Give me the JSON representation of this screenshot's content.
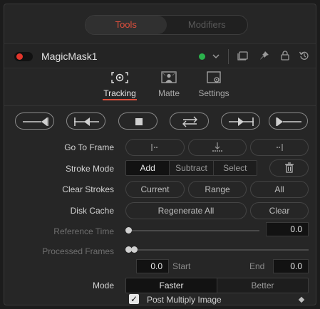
{
  "top_tabs": [
    {
      "label": "Tools",
      "active": true
    },
    {
      "label": "Modifiers",
      "active": false
    }
  ],
  "node": {
    "name": "MagicMask1",
    "enabled_color": "#e2352b",
    "status_color": "#2bb24c",
    "icons": [
      "chevron-down-icon",
      "version-icon",
      "pin-icon",
      "lock-icon",
      "reset-icon"
    ]
  },
  "sub_tabs": [
    {
      "label": "Tracking",
      "icon": "tracking-target-icon",
      "active": true
    },
    {
      "label": "Matte",
      "icon": "matte-icon",
      "active": false
    },
    {
      "label": "Settings",
      "icon": "settings-icon",
      "active": false
    }
  ],
  "transport": [
    "track-to-start",
    "track-backward-one-frame",
    "stop",
    "track-bidirectional",
    "track-forward-one-frame",
    "track-to-end"
  ],
  "go_to_frame": {
    "label": "Go To Frame",
    "icons": [
      "go-to-start-icon",
      "go-to-current-icon",
      "go-to-end-icon"
    ]
  },
  "stroke_mode": {
    "label": "Stroke Mode",
    "options": [
      "Add",
      "Subtract",
      "Select"
    ],
    "selected": "Add",
    "delete_icon": "trash-icon"
  },
  "clear_strokes": {
    "label": "Clear Strokes",
    "buttons": [
      "Current",
      "Range",
      "All"
    ]
  },
  "disk_cache": {
    "label": "Disk Cache",
    "regenerate": "Regenerate All",
    "clear": "Clear"
  },
  "reference_time": {
    "label": "Reference Time",
    "value": "0.0"
  },
  "processed_frames": {
    "label": "Processed Frames",
    "start_value": "0.0",
    "start_label": "Start",
    "end_label": "End",
    "end_value": "0.0"
  },
  "mode": {
    "label": "Mode",
    "options": [
      "Faster",
      "Better"
    ],
    "selected": "Faster"
  },
  "post_multiply": {
    "label": "Post Multiply Image",
    "checked": true,
    "check_glyph": "✓"
  },
  "colors": {
    "accent": "#e04f3c",
    "panel": "#262626"
  }
}
